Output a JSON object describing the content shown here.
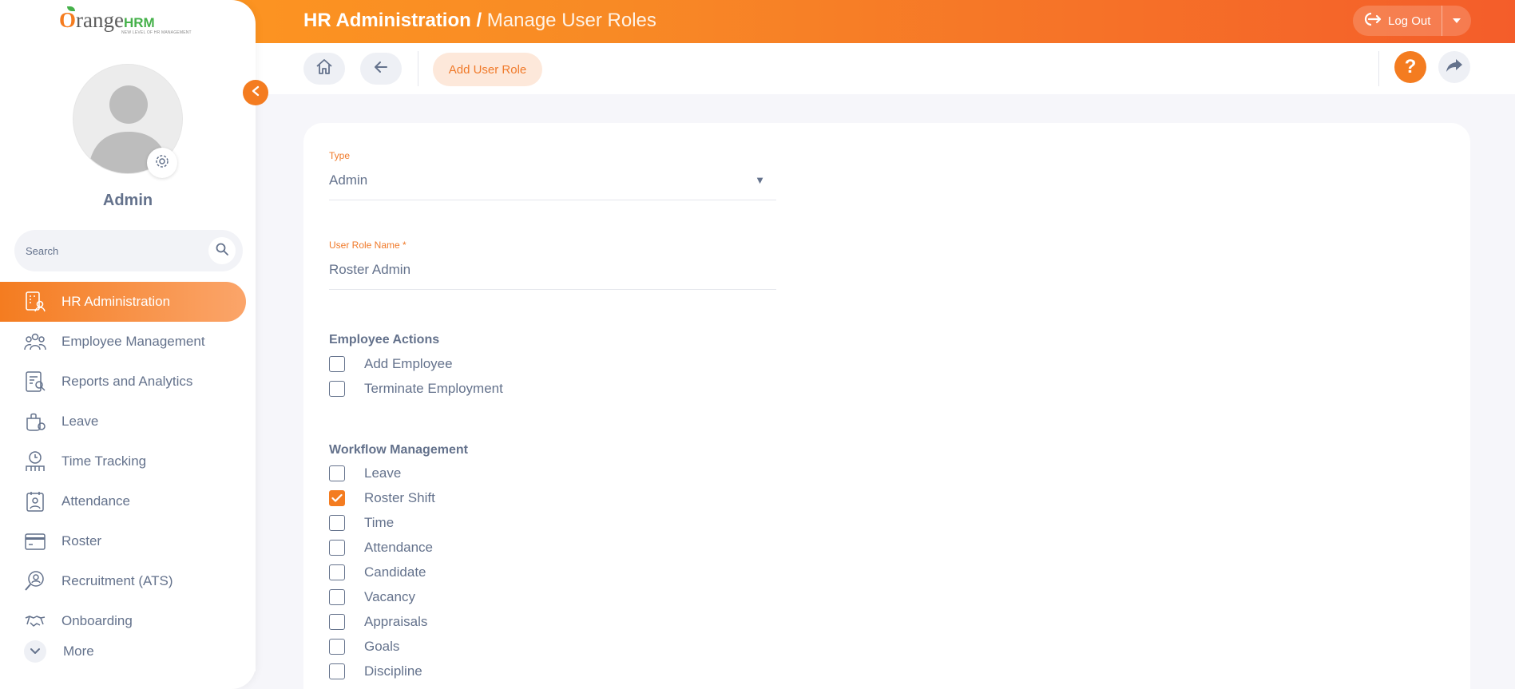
{
  "header": {
    "title_main": "HR Administration /",
    "title_sub": "Manage User Roles",
    "logout_label": "Log Out"
  },
  "toolbar": {
    "add_user_role_label": "Add User Role",
    "help_label": "?"
  },
  "sidebar": {
    "logo": {
      "brand_o": "O",
      "brand_rest": "range",
      "brand_hrm": "HRM",
      "tagline": "NEW LEVEL OF HR MANAGEMENT"
    },
    "username": "Admin",
    "search_placeholder": "Search",
    "items": [
      {
        "label": "HR Administration",
        "icon": "hr-admin-icon",
        "active": true
      },
      {
        "label": "Employee Management",
        "icon": "employee-management-icon"
      },
      {
        "label": "Reports and Analytics",
        "icon": "reports-icon"
      },
      {
        "label": "Leave",
        "icon": "leave-icon"
      },
      {
        "label": "Time Tracking",
        "icon": "time-tracking-icon"
      },
      {
        "label": "Attendance",
        "icon": "attendance-icon"
      },
      {
        "label": "Roster",
        "icon": "roster-icon"
      },
      {
        "label": "Recruitment (ATS)",
        "icon": "recruitment-icon"
      },
      {
        "label": "Onboarding",
        "icon": "onboarding-icon"
      }
    ],
    "more_label": "More"
  },
  "form": {
    "type": {
      "label": "Type",
      "value": "Admin"
    },
    "role_name": {
      "label": "User Role Name",
      "required_mark": "*",
      "value": "Roster Admin"
    },
    "employee_actions": {
      "title": "Employee Actions",
      "options": [
        {
          "label": "Add Employee",
          "checked": false
        },
        {
          "label": "Terminate Employment",
          "checked": false
        }
      ]
    },
    "workflow_management": {
      "title": "Workflow Management",
      "options": [
        {
          "label": "Leave",
          "checked": false
        },
        {
          "label": "Roster Shift",
          "checked": true
        },
        {
          "label": "Time",
          "checked": false
        },
        {
          "label": "Attendance",
          "checked": false
        },
        {
          "label": "Candidate",
          "checked": false
        },
        {
          "label": "Vacancy",
          "checked": false
        },
        {
          "label": "Appraisals",
          "checked": false
        },
        {
          "label": "Goals",
          "checked": false
        },
        {
          "label": "Discipline",
          "checked": false
        }
      ]
    }
  },
  "colors": {
    "accent": "#f47c20",
    "text": "#64728c",
    "background": "#f6f6fa"
  }
}
